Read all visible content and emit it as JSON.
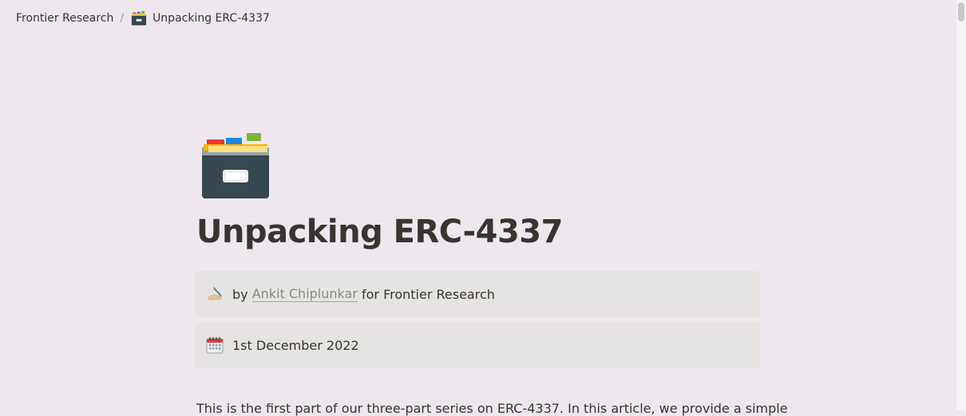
{
  "breadcrumb": {
    "root_label": "Frontier Research",
    "separator": "/",
    "current_icon": "card-file-box-icon",
    "current_label": "Unpacking ERC-4337"
  },
  "page": {
    "icon": "card-file-box-icon",
    "title": "Unpacking ERC-4337"
  },
  "callouts": {
    "author": {
      "icon": "writing-hand-icon",
      "prefix": "by",
      "author_name": "Ankit Chiplunkar",
      "suffix": "for Frontier Research"
    },
    "date": {
      "icon": "spiral-calendar-icon",
      "text": "1st December 2022"
    }
  },
  "body": {
    "first_paragraph": "This is the first part of our three-part series on ERC-4337. In this article, we provide a simple"
  },
  "colors": {
    "background": "#efe7ee",
    "callout_background": "#e6e4e2",
    "text": "#37352f",
    "link_muted": "#8a8884"
  }
}
